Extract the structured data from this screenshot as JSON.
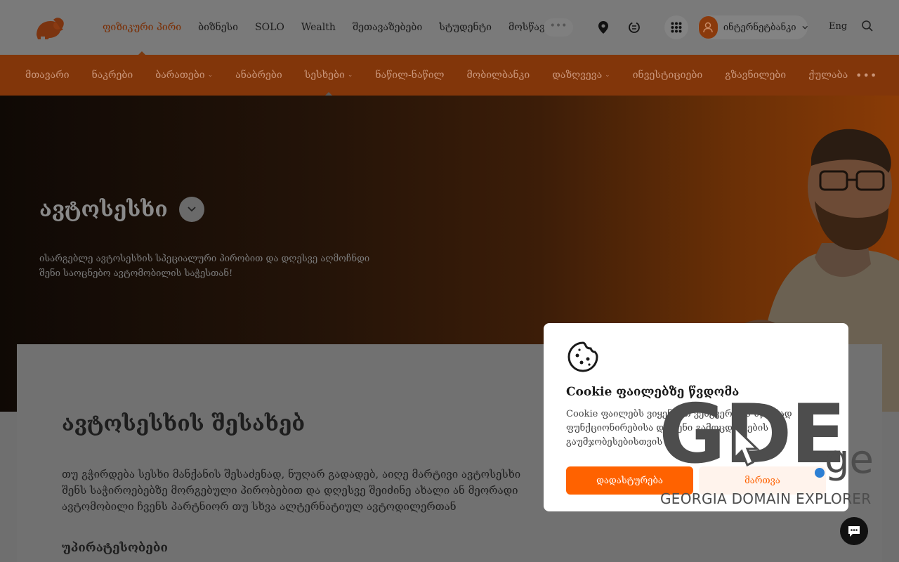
{
  "header": {
    "logo_icon": "lion-logo-icon",
    "nav": [
      "ფიზიკური პირი",
      "ბიზნესი",
      "SOLO",
      "Wealth",
      "შეთავაზებები",
      "სტუდენტი",
      "მოსწავლე"
    ],
    "nav_active_index": 0,
    "more_label": "•••",
    "location_icon": "location-pin-icon",
    "exchange_icon": "currency-exchange-icon",
    "apps_icon": "apps-grid-icon",
    "internet_bank_label": "ინტერნეტბანკი",
    "language": "Eng",
    "search_icon": "search-icon"
  },
  "subnav": {
    "items": [
      {
        "label": "მთავარი",
        "caret": false
      },
      {
        "label": "ნაკრები",
        "caret": false
      },
      {
        "label": "ბარათები",
        "caret": true
      },
      {
        "label": "ანაბრები",
        "caret": false
      },
      {
        "label": "სესხები",
        "caret": true,
        "active": true
      },
      {
        "label": "ნაწილ-ნაწილ",
        "caret": false
      },
      {
        "label": "მობილბანკი",
        "caret": false
      },
      {
        "label": "დაზღვევა",
        "caret": true
      },
      {
        "label": "ინვესტიციები",
        "caret": false
      },
      {
        "label": "გზავნილები",
        "caret": false
      },
      {
        "label": "ქულაბა",
        "caret": false
      }
    ],
    "more_label": "•••"
  },
  "hero": {
    "title": "ავტოსესხი",
    "description": "ისარგებლე ავტოსესხის სპეციალური პირობით და დღესვე აღმოჩნდი შენი საოცნებო ავტომობილის საჭესთან!"
  },
  "about": {
    "title": "ავტოსესხის შესახებ",
    "text": "თუ გჭირდება სესხი მანქანის შესაძენად, ნუღარ გადადებ, აიღე მარტივი ავტოსესხი შენს საჭიროებებზე მორგებული პირობებით და დღესვე შეიძინე ახალი ან მეორადი ავტომობილი ჩვენს პარტნიორ თუ სხვა ალტერნატიულ ავტოდილერთან",
    "advantages_title": "უპირატესობები"
  },
  "cookie": {
    "icon": "cookie-icon",
    "title": "Cookie ფაილებზე წვდომა",
    "text": "Cookie ფაილებს ვიყენებთ ვებგვერდის სწორად ფუნქციონირებისა და შენი გამოცდილების გაუმჯობესებისთვის",
    "accept_label": "დადასტურება",
    "manage_label": "მართვა"
  },
  "watermark": {
    "brand": "GDE",
    "tld": "ge",
    "subtitle": "GEORGIA DOMAIN EXPLORER"
  },
  "chat": {
    "icon": "chat-bubble-icon"
  },
  "colors": {
    "accent": "#ff6200",
    "brand_dim": "#82360a"
  }
}
